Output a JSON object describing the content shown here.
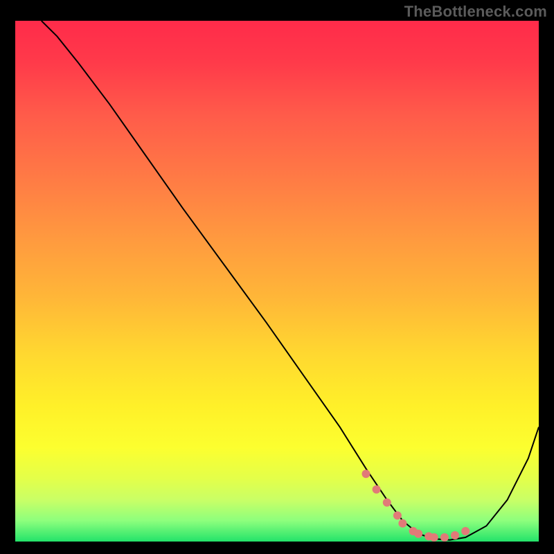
{
  "watermark": "TheBottleneck.com",
  "chart_data": {
    "type": "line",
    "title": "",
    "xlabel": "",
    "ylabel": "",
    "xlim": [
      0,
      100
    ],
    "ylim": [
      0,
      100
    ],
    "grid": false,
    "legend": false,
    "background": "heatmap-gradient",
    "gradient_stops": [
      {
        "pos": 0,
        "color": "#ff2b4a"
      },
      {
        "pos": 50,
        "color": "#ffc030"
      },
      {
        "pos": 85,
        "color": "#fcff2f"
      },
      {
        "pos": 100,
        "color": "#23e36a"
      }
    ],
    "series": [
      {
        "name": "bottleneck-curve",
        "color": "#000000",
        "stroke_width": 2,
        "x": [
          5,
          8,
          12,
          18,
          25,
          32,
          40,
          48,
          55,
          62,
          67,
          71,
          74,
          77,
          80,
          83,
          86,
          90,
          94,
          98,
          100
        ],
        "y": [
          100,
          97,
          92,
          84,
          74,
          64,
          53,
          42,
          32,
          22,
          14,
          8,
          4,
          1.5,
          0.5,
          0.3,
          0.8,
          3,
          8,
          16,
          22
        ]
      },
      {
        "name": "valley-markers",
        "type": "scatter",
        "color": "#e17a78",
        "marker_size": 6,
        "x": [
          67,
          69,
          71,
          73,
          74,
          76,
          77,
          79,
          80,
          82,
          84,
          86
        ],
        "y": [
          13,
          10,
          7.5,
          5,
          3.5,
          2,
          1.5,
          1,
          0.8,
          0.8,
          1.2,
          2
        ]
      }
    ],
    "annotations": []
  }
}
